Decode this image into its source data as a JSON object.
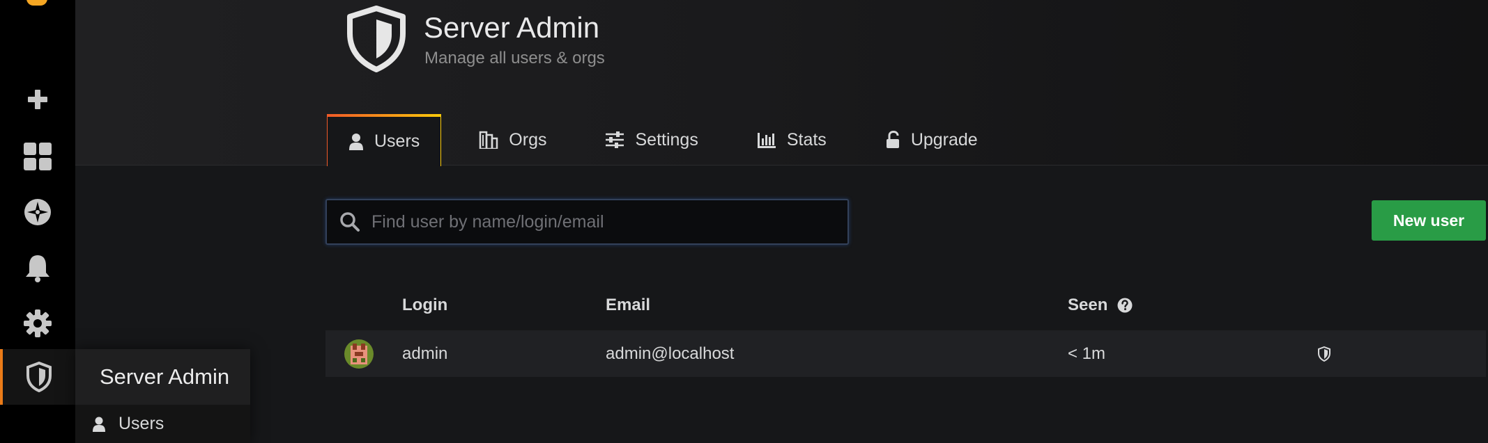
{
  "header": {
    "title": "Server Admin",
    "subtitle": "Manage all users & orgs"
  },
  "tabs": [
    {
      "label": "Users",
      "icon": "user-icon",
      "active": true
    },
    {
      "label": "Orgs",
      "icon": "building-icon",
      "active": false
    },
    {
      "label": "Settings",
      "icon": "sliders-icon",
      "active": false
    },
    {
      "label": "Stats",
      "icon": "bar-chart-icon",
      "active": false
    },
    {
      "label": "Upgrade",
      "icon": "unlock-icon",
      "active": false
    }
  ],
  "search": {
    "placeholder": "Find user by name/login/email",
    "value": ""
  },
  "new_user_button": "New user",
  "table": {
    "columns": [
      "Login",
      "Email",
      "Seen"
    ],
    "rows": [
      {
        "login": "admin",
        "email": "admin@localhost",
        "seen": "< 1m",
        "is_admin": true
      }
    ]
  },
  "sidenav": {
    "items": [
      "plus-icon",
      "dashboards-icon",
      "explore-icon",
      "alerting-icon",
      "configuration-icon",
      "server-admin-icon"
    ],
    "active": "server-admin-icon"
  },
  "flyout": {
    "title": "Server Admin",
    "items": [
      {
        "label": "Users",
        "icon": "user-icon"
      }
    ]
  },
  "colors": {
    "accent": "#eb7b18",
    "primary_button": "#299c46",
    "background": "#161719",
    "sidenav": "#000000"
  }
}
